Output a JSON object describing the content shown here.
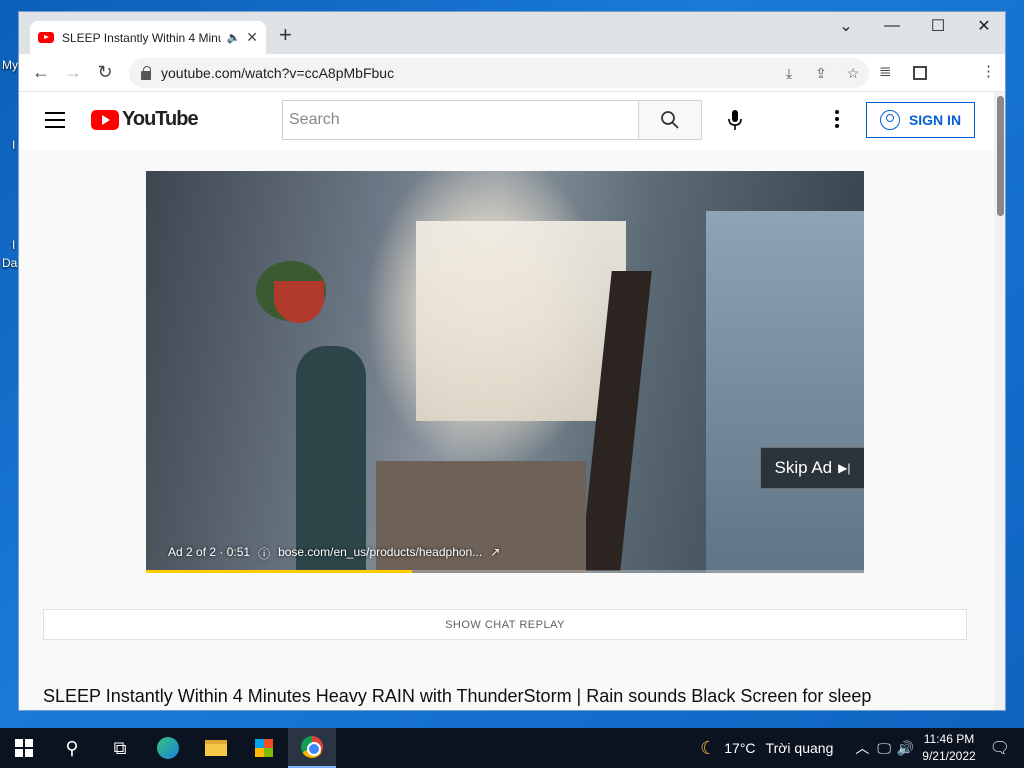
{
  "desktop": {
    "labels": [
      "My",
      "I",
      "I",
      "Da"
    ]
  },
  "browser": {
    "tab": {
      "title": "SLEEP Instantly Within 4 Minutes Heavy RAIN with ThunderStorm | Rain sounds Black Screen for sleep",
      "audio_icon": "speaker-icon",
      "close": "✕"
    },
    "new_tab": "+",
    "window_controls": {
      "min": "—",
      "max": "☐",
      "close": "✕",
      "dropdown": "⌄"
    },
    "url": "youtube.com/watch?v=ccA8pMbFbuc"
  },
  "youtube": {
    "logo_text": "YouTube",
    "search_placeholder": "Search",
    "sign_in": "SIGN IN",
    "ad": {
      "info": "Ad 2 of 2 · 0:51",
      "link": "bose.com/en_us/products/headphon...",
      "skip": "Skip Ad",
      "progress": 0.37
    },
    "chat_replay": "SHOW CHAT REPLAY",
    "video_title": "SLEEP Instantly Within 4 Minutes Heavy RAIN with ThunderStorm | Rain sounds Black Screen for sleep"
  },
  "taskbar": {
    "weather": {
      "temp": "17°C",
      "text": "Trời quang"
    },
    "time": "11:46 PM",
    "date": "9/21/2022"
  },
  "colors": {
    "accent": "#065fd4",
    "yt_red": "#ff0000",
    "ad_progress": "#ffcc00"
  }
}
